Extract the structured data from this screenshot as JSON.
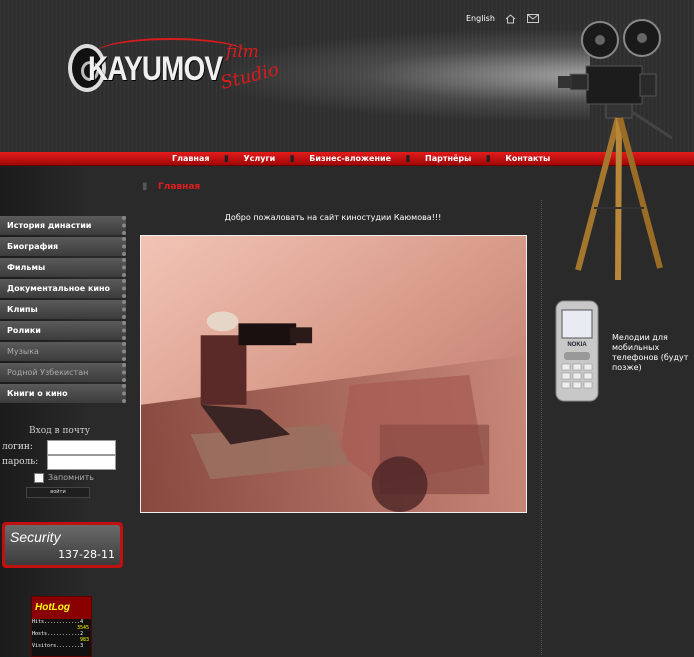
{
  "header": {
    "language_link": "English",
    "icons": [
      "home-icon",
      "mail-icon"
    ],
    "logo": {
      "main": "KAYUMOV",
      "film": "film",
      "studio": "Studio"
    }
  },
  "nav": {
    "items": [
      "Главная",
      "Услуги",
      "Бизнес-вложение",
      "Партнёры",
      "Контакты"
    ]
  },
  "sidebar": {
    "menu": [
      "История династии",
      "Биография",
      "Фильмы",
      "Документальное кино",
      "Клипы",
      "Ролики",
      "Музыка",
      "Родной Узбекистан",
      "Книги о кино"
    ],
    "login": {
      "title": "Вход в почту",
      "login_label": "логин:",
      "password_label": "пароль:",
      "remember_label": "Запомнить",
      "submit_label": "войти"
    },
    "security": {
      "title": "Security",
      "phone": "137-28-11"
    },
    "hotlog": {
      "title": "HotLog",
      "rows": [
        {
          "label": "Hits............4",
          "value": "3545"
        },
        {
          "label": "Hosts...........2",
          "value": "983"
        },
        {
          "label": "Visitors........3",
          "value": ""
        }
      ]
    }
  },
  "main": {
    "breadcrumb": "Главная",
    "welcome": "Добро пожаловать на сайт киностудии Каюмова!!!"
  },
  "right": {
    "melody_text": "Мелодии для мобильных телефонов (будут позже)",
    "phone_brand": "NOKIA"
  },
  "colors": {
    "accent": "#e31d1d",
    "background": "#2a2a2a"
  }
}
